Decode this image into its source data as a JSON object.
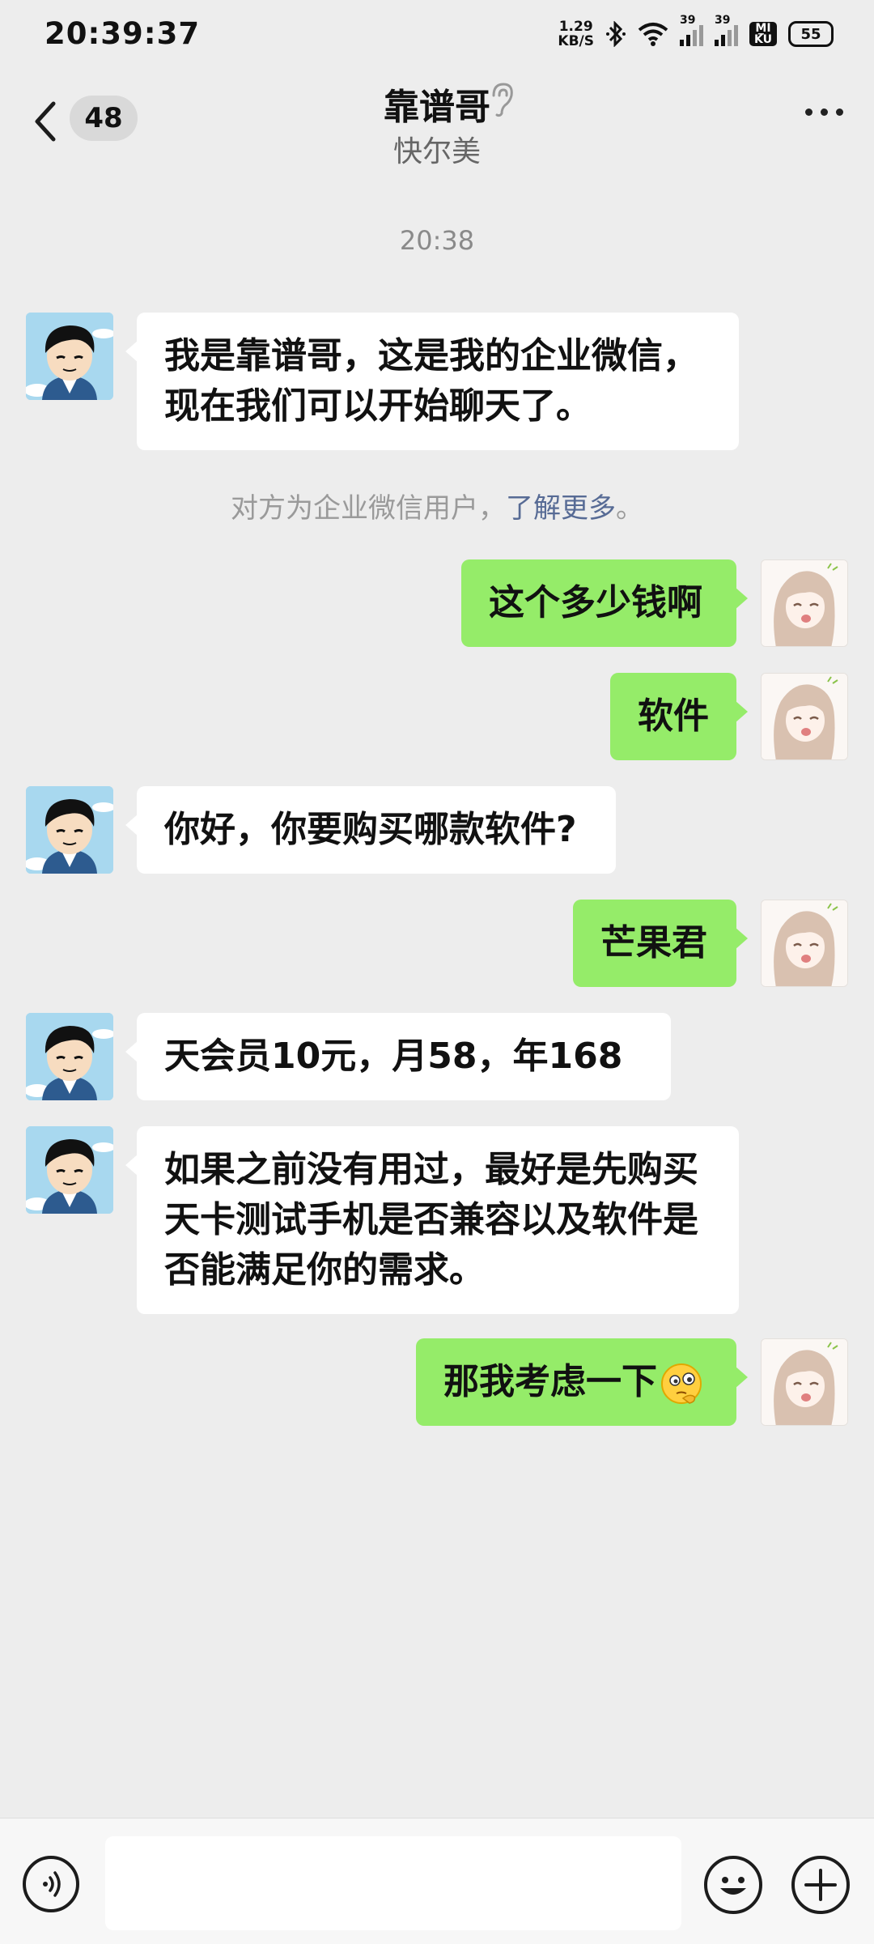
{
  "status_bar": {
    "time": "20:39:37",
    "net_speed_value": "1.29",
    "net_speed_unit": "KB/S",
    "signal1_label": "39",
    "signal2_label": "39",
    "mi_label": "MI\nKU",
    "battery": "55"
  },
  "header": {
    "unread_count": "48",
    "title": "靠谱哥",
    "subtitle": "快尔美"
  },
  "timestamp": "20:38",
  "system_note": {
    "text": "对方为企业微信用户，",
    "link": "了解更多",
    "suffix": "。"
  },
  "messages": [
    {
      "side": "in",
      "text": "我是靠谱哥，这是我的企业微信，现在我们可以开始聊天了。"
    },
    {
      "side": "out",
      "text": "这个多少钱啊"
    },
    {
      "side": "out",
      "text": "软件"
    },
    {
      "side": "in",
      "text": "你好，你要购买哪款软件?"
    },
    {
      "side": "out",
      "text": "芒果君"
    },
    {
      "side": "in",
      "text": "天会员10元，月58，年168"
    },
    {
      "side": "in",
      "text": "如果之前没有用过，最好是先购买天卡测试手机是否兼容以及软件是否能满足你的需求。"
    },
    {
      "side": "out",
      "text": "那我考虑一下"
    }
  ],
  "colors": {
    "background": "#ededed",
    "outgoing_bubble": "#95ec69",
    "incoming_bubble": "#ffffff",
    "link": "#576b95"
  },
  "icons": [
    "back-icon",
    "ear-icon",
    "more-icon",
    "voice-icon",
    "emoji-icon",
    "plus-icon"
  ]
}
